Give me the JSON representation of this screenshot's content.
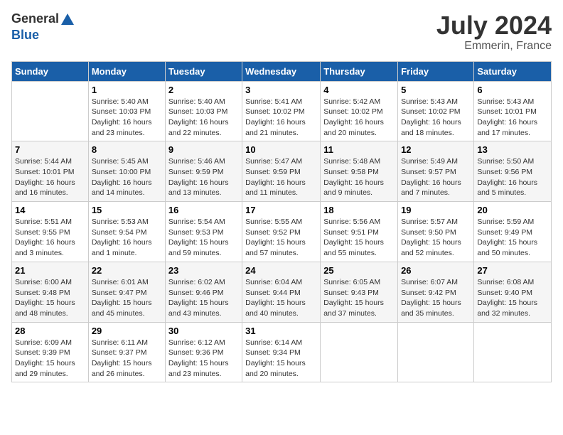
{
  "header": {
    "logo": {
      "general": "General",
      "blue": "Blue"
    },
    "title": "July 2024",
    "location": "Emmerin, France"
  },
  "calendar": {
    "days_of_week": [
      "Sunday",
      "Monday",
      "Tuesday",
      "Wednesday",
      "Thursday",
      "Friday",
      "Saturday"
    ],
    "weeks": [
      [
        {
          "day": null
        },
        {
          "day": 1,
          "sunrise": "5:40 AM",
          "sunset": "10:03 PM",
          "daylight": "16 hours and 23 minutes."
        },
        {
          "day": 2,
          "sunrise": "5:40 AM",
          "sunset": "10:03 PM",
          "daylight": "16 hours and 22 minutes."
        },
        {
          "day": 3,
          "sunrise": "5:41 AM",
          "sunset": "10:02 PM",
          "daylight": "16 hours and 21 minutes."
        },
        {
          "day": 4,
          "sunrise": "5:42 AM",
          "sunset": "10:02 PM",
          "daylight": "16 hours and 20 minutes."
        },
        {
          "day": 5,
          "sunrise": "5:43 AM",
          "sunset": "10:02 PM",
          "daylight": "16 hours and 18 minutes."
        },
        {
          "day": 6,
          "sunrise": "5:43 AM",
          "sunset": "10:01 PM",
          "daylight": "16 hours and 17 minutes."
        }
      ],
      [
        {
          "day": 7,
          "sunrise": "5:44 AM",
          "sunset": "10:01 PM",
          "daylight": "16 hours and 16 minutes."
        },
        {
          "day": 8,
          "sunrise": "5:45 AM",
          "sunset": "10:00 PM",
          "daylight": "16 hours and 14 minutes."
        },
        {
          "day": 9,
          "sunrise": "5:46 AM",
          "sunset": "9:59 PM",
          "daylight": "16 hours and 13 minutes."
        },
        {
          "day": 10,
          "sunrise": "5:47 AM",
          "sunset": "9:59 PM",
          "daylight": "16 hours and 11 minutes."
        },
        {
          "day": 11,
          "sunrise": "5:48 AM",
          "sunset": "9:58 PM",
          "daylight": "16 hours and 9 minutes."
        },
        {
          "day": 12,
          "sunrise": "5:49 AM",
          "sunset": "9:57 PM",
          "daylight": "16 hours and 7 minutes."
        },
        {
          "day": 13,
          "sunrise": "5:50 AM",
          "sunset": "9:56 PM",
          "daylight": "16 hours and 5 minutes."
        }
      ],
      [
        {
          "day": 14,
          "sunrise": "5:51 AM",
          "sunset": "9:55 PM",
          "daylight": "16 hours and 3 minutes."
        },
        {
          "day": 15,
          "sunrise": "5:53 AM",
          "sunset": "9:54 PM",
          "daylight": "16 hours and 1 minute."
        },
        {
          "day": 16,
          "sunrise": "5:54 AM",
          "sunset": "9:53 PM",
          "daylight": "15 hours and 59 minutes."
        },
        {
          "day": 17,
          "sunrise": "5:55 AM",
          "sunset": "9:52 PM",
          "daylight": "15 hours and 57 minutes."
        },
        {
          "day": 18,
          "sunrise": "5:56 AM",
          "sunset": "9:51 PM",
          "daylight": "15 hours and 55 minutes."
        },
        {
          "day": 19,
          "sunrise": "5:57 AM",
          "sunset": "9:50 PM",
          "daylight": "15 hours and 52 minutes."
        },
        {
          "day": 20,
          "sunrise": "5:59 AM",
          "sunset": "9:49 PM",
          "daylight": "15 hours and 50 minutes."
        }
      ],
      [
        {
          "day": 21,
          "sunrise": "6:00 AM",
          "sunset": "9:48 PM",
          "daylight": "15 hours and 48 minutes."
        },
        {
          "day": 22,
          "sunrise": "6:01 AM",
          "sunset": "9:47 PM",
          "daylight": "15 hours and 45 minutes."
        },
        {
          "day": 23,
          "sunrise": "6:02 AM",
          "sunset": "9:46 PM",
          "daylight": "15 hours and 43 minutes."
        },
        {
          "day": 24,
          "sunrise": "6:04 AM",
          "sunset": "9:44 PM",
          "daylight": "15 hours and 40 minutes."
        },
        {
          "day": 25,
          "sunrise": "6:05 AM",
          "sunset": "9:43 PM",
          "daylight": "15 hours and 37 minutes."
        },
        {
          "day": 26,
          "sunrise": "6:07 AM",
          "sunset": "9:42 PM",
          "daylight": "15 hours and 35 minutes."
        },
        {
          "day": 27,
          "sunrise": "6:08 AM",
          "sunset": "9:40 PM",
          "daylight": "15 hours and 32 minutes."
        }
      ],
      [
        {
          "day": 28,
          "sunrise": "6:09 AM",
          "sunset": "9:39 PM",
          "daylight": "15 hours and 29 minutes."
        },
        {
          "day": 29,
          "sunrise": "6:11 AM",
          "sunset": "9:37 PM",
          "daylight": "15 hours and 26 minutes."
        },
        {
          "day": 30,
          "sunrise": "6:12 AM",
          "sunset": "9:36 PM",
          "daylight": "15 hours and 23 minutes."
        },
        {
          "day": 31,
          "sunrise": "6:14 AM",
          "sunset": "9:34 PM",
          "daylight": "15 hours and 20 minutes."
        },
        {
          "day": null
        },
        {
          "day": null
        },
        {
          "day": null
        }
      ]
    ]
  }
}
